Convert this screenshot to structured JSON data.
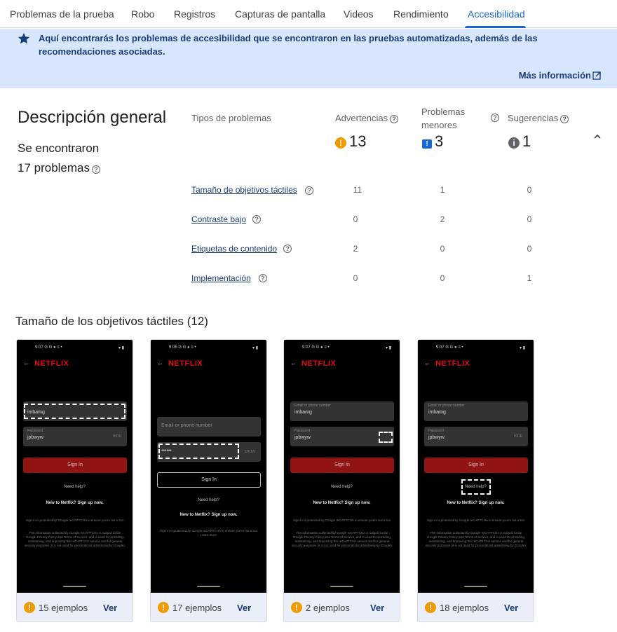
{
  "tabs": [
    "Problemas de la prueba",
    "Robo",
    "Registros",
    "Capturas de pantalla",
    "Videos",
    "Rendimiento",
    "Accesibilidad"
  ],
  "active_tab": "Accesibilidad",
  "banner": {
    "text": "Aquí encontrarás los problemas de accesibilidad que se encontraron en las pruebas automatizadas, además de las recomendaciones asociadas.",
    "link": "Más información",
    "icon": "star-icon"
  },
  "overview": {
    "title": "Descripción general",
    "found_line1": "Se encontraron",
    "found_line2": "17 problemas",
    "col_types": "Tipos de problemas",
    "col_warnings": "Advertencias",
    "col_minor_line1": "Problemas",
    "col_minor_line2": "menores",
    "col_suggestions": "Sugerencias",
    "warnings_total": "13",
    "minor_total": "3",
    "suggestions_total": "1",
    "rows": [
      {
        "label": "Tamaño de objetivos táctiles",
        "warnings": "11",
        "minor": "1",
        "suggestions": "0"
      },
      {
        "label": "Contraste bajo",
        "warnings": "0",
        "minor": "2",
        "suggestions": "0"
      },
      {
        "label": "Etiquetas de contenido",
        "warnings": "2",
        "minor": "0",
        "suggestions": "0"
      },
      {
        "label": "Implementación",
        "warnings": "0",
        "minor": "0",
        "suggestions": "1"
      }
    ]
  },
  "section": {
    "title": "Tamaño de los objetivos táctiles (12)",
    "view_label": "Ver",
    "cards": [
      {
        "examples": "15 ejemplos",
        "time": "9:07"
      },
      {
        "examples": "17 ejemplos",
        "time": "9:06"
      },
      {
        "examples": "2 ejemplos",
        "time": "9:07"
      },
      {
        "examples": "18 ejemplos",
        "time": "9:07"
      }
    ]
  },
  "phone": {
    "status_icons": "G G ● ≡ •",
    "status_right": "▾ ▮",
    "back": "←",
    "logo": "NETFLIX",
    "email_placeholder": "Email or phone number",
    "email_value": "imbamg",
    "password_placeholder": "Password",
    "password_value": "jpbwyw",
    "password_masked": "••••••",
    "hide": "HIDE",
    "show": "SHOW",
    "sign_in": "Sign In",
    "need_help": "Need help?",
    "new_to": "New to Netflix? Sign up now.",
    "recaptcha": "Sign in is protected by Google reCAPTCHA to ensure you're not a bot.",
    "recaptcha_short": "Sign in is protected by Google reCAPTCHA to ensure you're not a bot. Learn more.",
    "info": "The information collected by Google reCAPTCHA is subject to the Google Privacy Policy and Terms of Service, and is used for providing, maintaining, and improving the reCAPTCHA service and for general security purposes (it is not used for personalized advertising by Google)."
  },
  "colors": {
    "accent": "#1967d2",
    "banner_bg": "#d7e6fc",
    "warning": "#f29900",
    "netflix_red": "#e50914"
  }
}
